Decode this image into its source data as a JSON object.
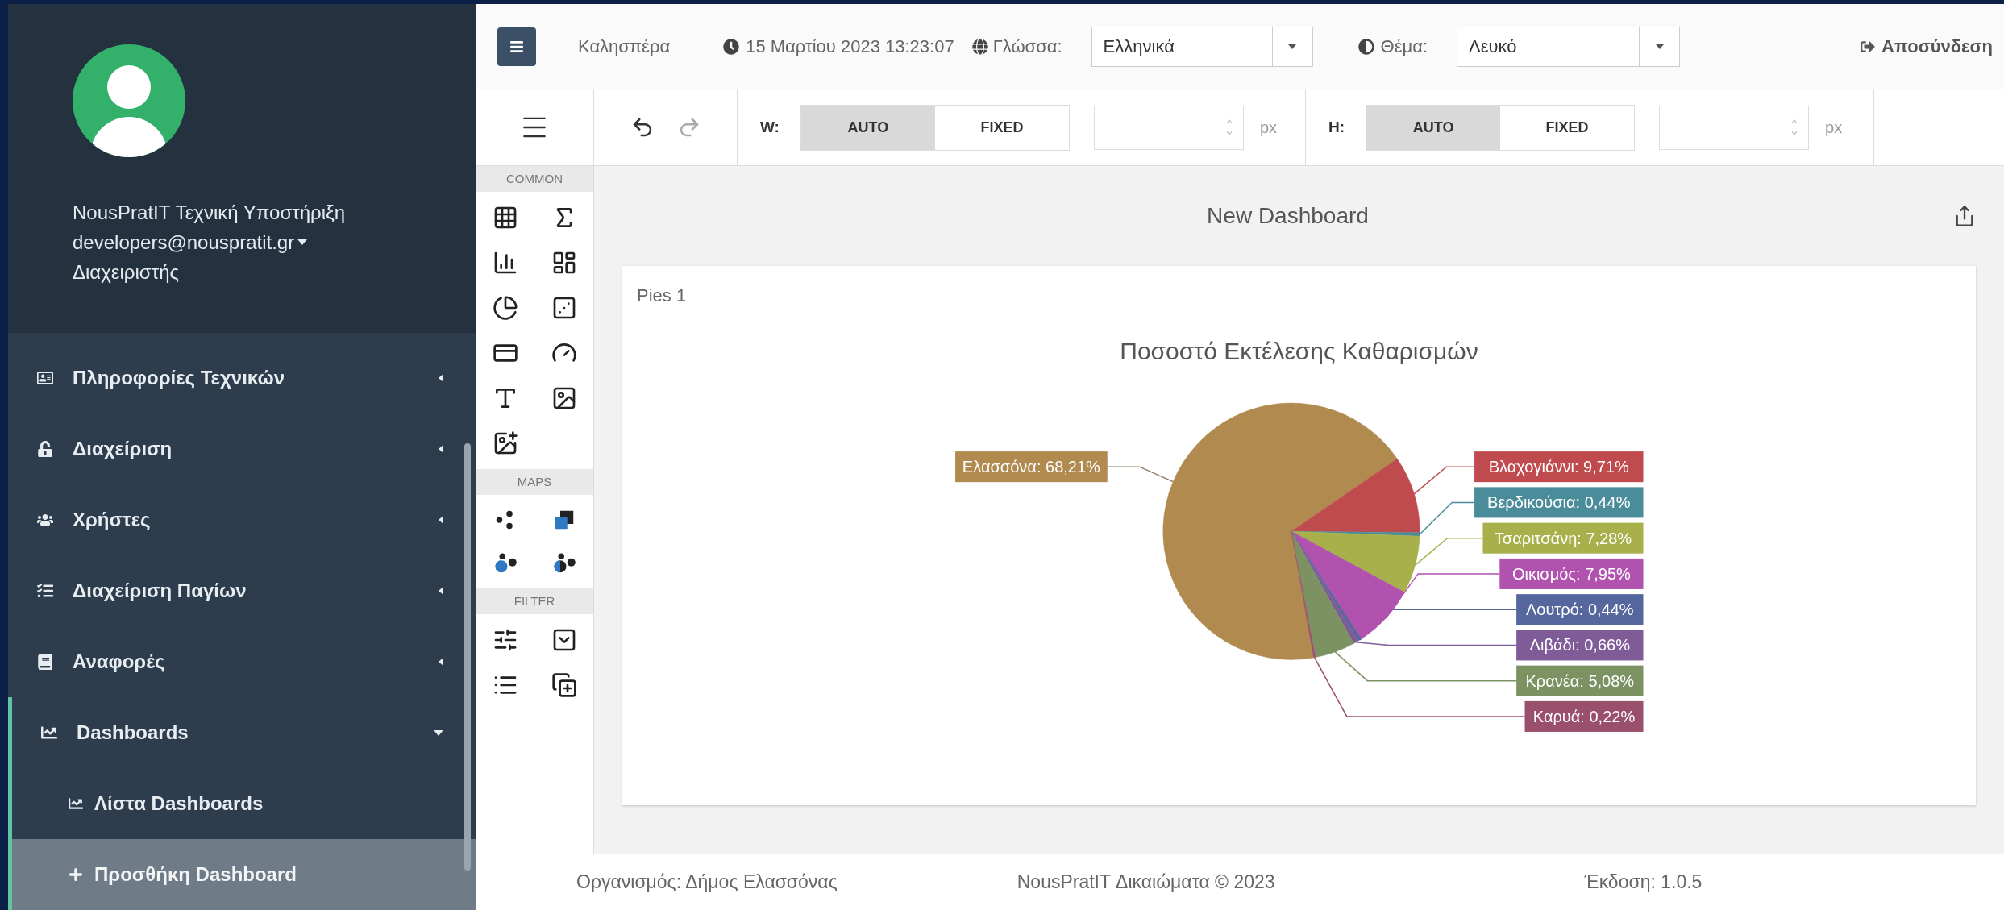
{
  "user": {
    "name": "NousPratIT Τεχνική Υποστήριξη",
    "email": "developers@nouspratit.gr",
    "role": "Διαχειριστής"
  },
  "menu": [
    {
      "label": "Πληροφορίες Τεχνικών",
      "expanded": false,
      "selected": false
    },
    {
      "label": "Διαχείριση",
      "expanded": false,
      "selected": false
    },
    {
      "label": "Χρήστες",
      "expanded": false,
      "selected": false
    },
    {
      "label": "Διαχείριση Παγίων",
      "expanded": false,
      "selected": false
    },
    {
      "label": "Αναφορές",
      "expanded": false,
      "selected": false
    },
    {
      "label": "Dashboards",
      "expanded": true,
      "selected": false,
      "children": [
        {
          "label": "Λίστα Dashboards",
          "selected": false
        },
        {
          "label": "Προσθήκη Dashboard",
          "selected": true
        }
      ]
    }
  ],
  "topbar": {
    "greeting": "Καλησπέρα",
    "datetime": "15 Μαρτίου 2023 13:23:07",
    "language_label": "Γλώσσα:",
    "language_value": "Ελληνικά",
    "theme_label": "Θέμα:",
    "theme_value": "Λευκό",
    "logout": "Αποσύνδεση"
  },
  "toolbar": {
    "groups": [
      {
        "label": "W:",
        "modes": [
          {
            "label": "AUTO",
            "selected": true
          },
          {
            "label": "FIXED",
            "selected": false
          }
        ],
        "unit": "px"
      },
      {
        "label": "H:",
        "modes": [
          {
            "label": "AUTO",
            "selected": true
          },
          {
            "label": "FIXED",
            "selected": false
          }
        ],
        "unit": "px"
      }
    ]
  },
  "toolbox": {
    "sections": [
      {
        "title": "COMMON"
      },
      {
        "title": "MAPS"
      },
      {
        "title": "FILTER"
      }
    ]
  },
  "dashboard": {
    "title": "New Dashboard",
    "item": {
      "caption": "Pies 1",
      "chart_data": {
        "type": "pie",
        "title": "Ποσοστό Εκτέλεσης Καθαρισμών",
        "categories": [
          "Ελασσόνα",
          "Βλαχογιάννι",
          "Βερδικούσια",
          "Τσαριτσάνη",
          "Οικισμός",
          "Λουτρό",
          "Λιβάδι",
          "Κρανέα",
          "Καρυά"
        ],
        "series": [
          {
            "values": [
              68.21,
              9.71,
              0.44,
              7.28,
              7.95,
              0.44,
              0.66,
              5.08,
              0.22
            ]
          }
        ],
        "colors": [
          "#b08a4e",
          "#c04b4f",
          "#4b8c9b",
          "#a7b04b",
          "#b052ae",
          "#55679c",
          "#7f5b98",
          "#7d9262",
          "#9a4f6c"
        ],
        "value_labels": [
          ": 68,21%",
          ": 9,71%",
          ": 0,44%",
          ": 7,28%",
          ": 7,95%",
          ": 0,44%",
          ": 0,66%",
          ": 5,08%",
          ": 0,22%"
        ]
      }
    }
  },
  "footer": {
    "organization": "Οργανισμός: Δήμος Ελασσόνας",
    "copyright": "NousPratIT Δικαιώματα © 2023",
    "version": "Έκδοση: 1.0.5"
  }
}
